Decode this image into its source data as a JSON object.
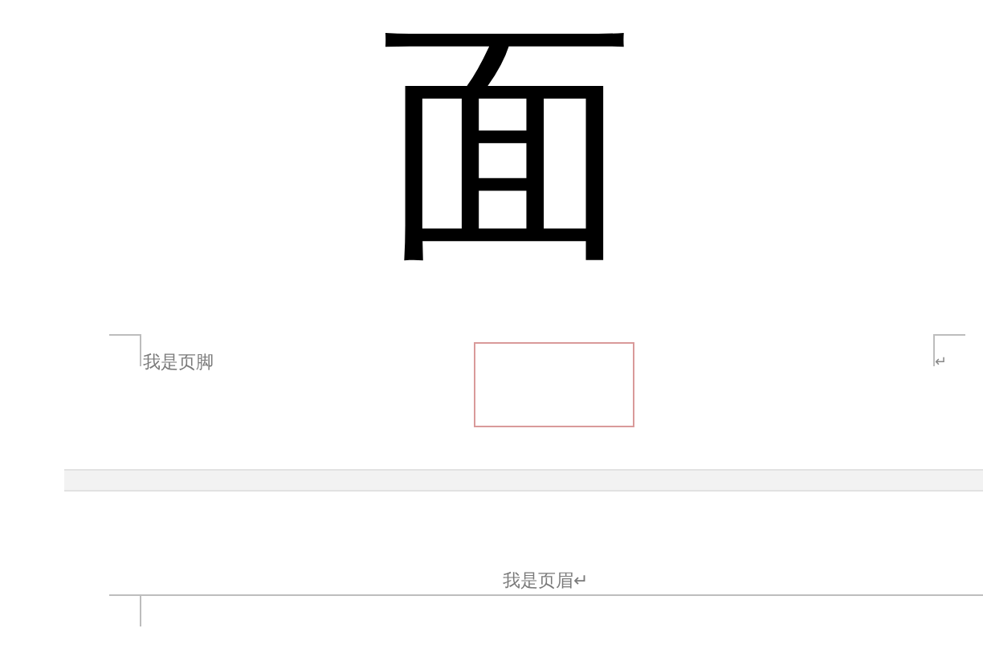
{
  "page_1": {
    "body_text": "面",
    "footer": {
      "text": "我是页脚",
      "end_mark": "↵"
    }
  },
  "page_2": {
    "header": {
      "text": "我是页眉↵"
    }
  }
}
